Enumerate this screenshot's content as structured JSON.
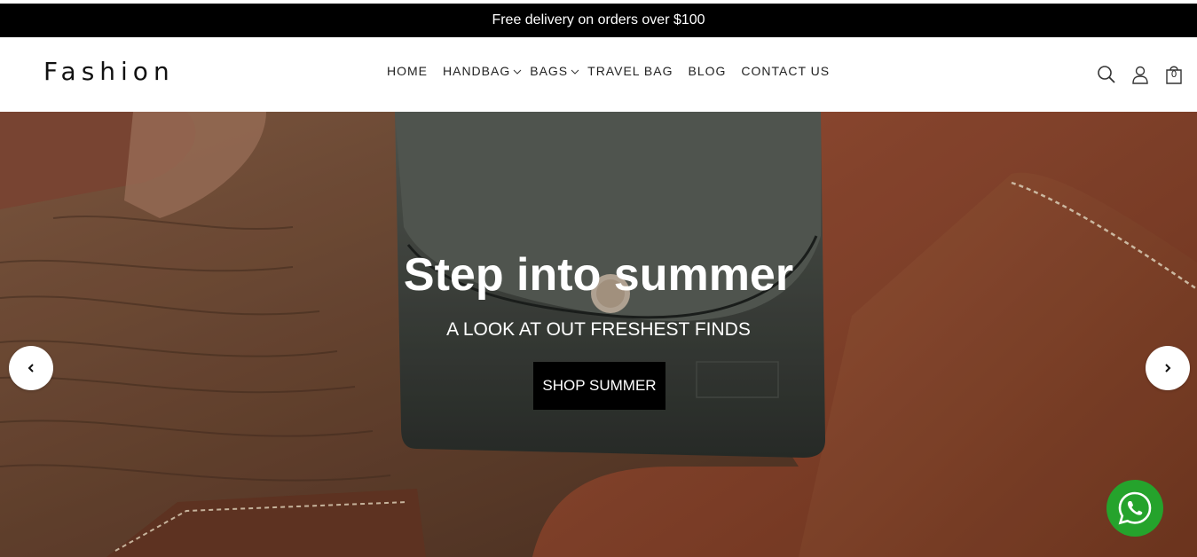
{
  "announcement": {
    "text": "Free delivery on orders over $100"
  },
  "header": {
    "logo": "Fashion",
    "nav": [
      {
        "label": "HOME",
        "has_submenu": false
      },
      {
        "label": "HANDBAG",
        "has_submenu": true
      },
      {
        "label": "BAGS",
        "has_submenu": true
      },
      {
        "label": "TRAVEL BAG",
        "has_submenu": false
      },
      {
        "label": "BLOG",
        "has_submenu": false
      },
      {
        "label": "CONTACT US",
        "has_submenu": false
      }
    ],
    "icons": [
      "search-icon",
      "account-icon",
      "cart-icon"
    ],
    "cart_count": "0"
  },
  "hero": {
    "title": "Step into summer",
    "subtitle": "A LOOK AT OUT FRESHEST FINDS",
    "button_label": "SHOP SUMMER",
    "prev_icon": "chevron-left-icon",
    "next_icon": "chevron-right-icon"
  },
  "floating": {
    "icon": "whatsapp-icon",
    "color": "#25a32c"
  },
  "colors": {
    "announcement_bg": "#000000",
    "button_bg": "#000000"
  }
}
